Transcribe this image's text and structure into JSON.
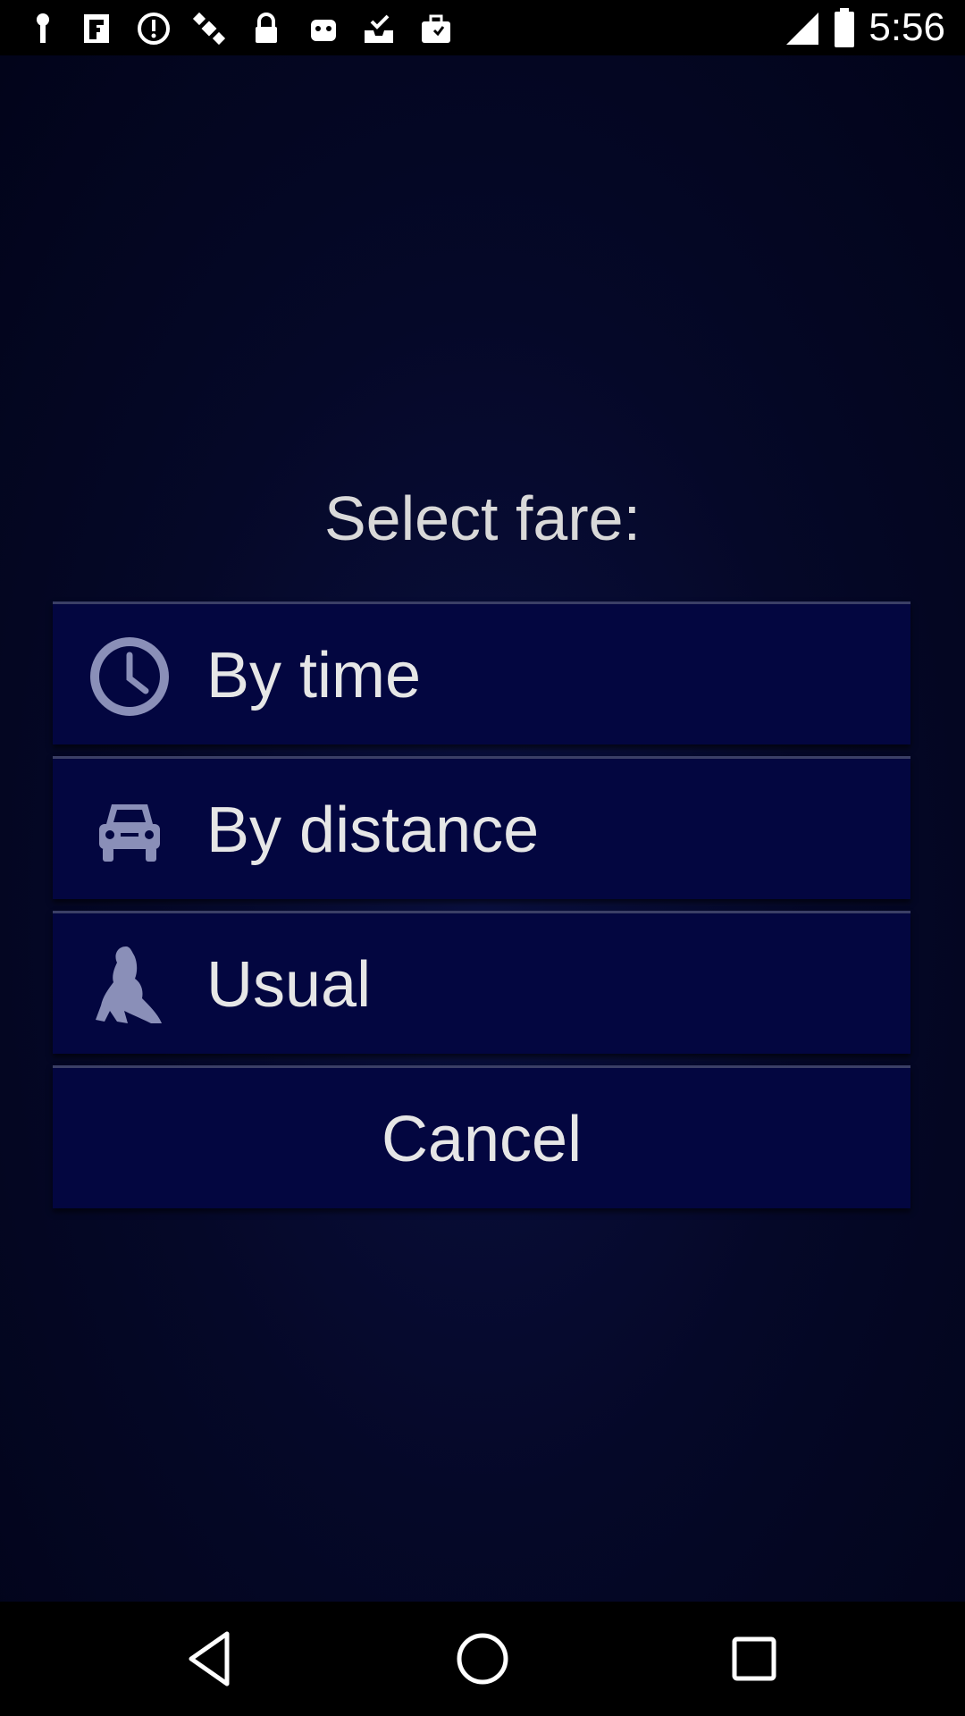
{
  "status_bar": {
    "time": "5:56",
    "left_icons": [
      "pin-icon",
      "fake-gps-icon",
      "alarm-icon",
      "satellite-icon",
      "lock-icon",
      "android-icon",
      "inbox-check-icon",
      "briefcase-icon"
    ],
    "right_icons": [
      "signal-icon",
      "battery-icon"
    ]
  },
  "dialog": {
    "title": "Select fare:",
    "options": [
      {
        "label": "By time",
        "icon": "clock-icon"
      },
      {
        "label": "By distance",
        "icon": "car-icon"
      },
      {
        "label": "Usual",
        "icon": "woman-silhouette-icon"
      }
    ],
    "cancel_label": "Cancel"
  },
  "nav_bar": {
    "icons": [
      "back-icon",
      "home-icon",
      "recents-icon"
    ]
  },
  "colors": {
    "background": "#050828",
    "button": "#030640",
    "text": "#e6e6e6",
    "icon": "#8a8fb8"
  }
}
